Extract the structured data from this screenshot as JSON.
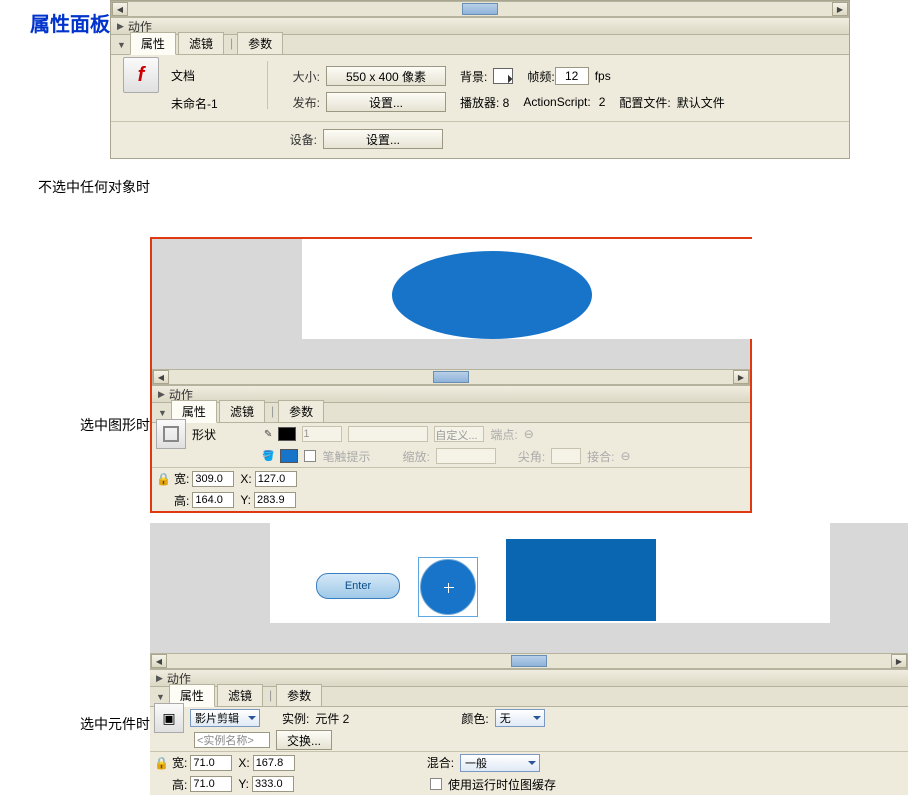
{
  "title": "属性面板",
  "labels": {
    "no_selection": "不选中任何对象时",
    "shape_selected": "选中图形时",
    "symbol_selected": "选中元件时"
  },
  "panel_header": {
    "actions": "动作"
  },
  "tabs": {
    "properties": "属性",
    "filters": "滤镜",
    "params": "参数"
  },
  "p1": {
    "doc_type": "文档",
    "doc_name": "未命名-1",
    "size_k": "大小:",
    "size_btn": "550 x 400 像素",
    "bg_k": "背景:",
    "fps_k": "帧频:",
    "fps_v": "12",
    "fps_unit": "fps",
    "publish_k": "发布:",
    "settings_btn": "设置...",
    "player_k": "播放器: 8",
    "as_k": "ActionScript:",
    "as_v": "2",
    "profile_k": "配置文件:",
    "profile_v": "默认文件",
    "device_k": "设备:"
  },
  "p2": {
    "shape_label": "形状",
    "stroke_hint": "1",
    "brush_hint": "笔触提示",
    "scale_k": "缩放:",
    "custom": "自定义...",
    "cap_k": "端点:",
    "miter_k": "尖角:",
    "join_k": "接合:",
    "w_k": "宽:",
    "w_v": "309.0",
    "h_k": "高:",
    "h_v": "164.0",
    "x_k": "X:",
    "x_v": "127.0",
    "y_k": "Y:",
    "y_v": "283.9"
  },
  "p3": {
    "enter_text": "Enter",
    "type_dd": "影片剪辑",
    "instance_k": "实例:",
    "instance_v": "元件 2",
    "color_k": "颜色:",
    "color_v": "无",
    "instance_name_ph": "<实例名称>",
    "swap_btn": "交换...",
    "blend_k": "混合:",
    "blend_v": "一般",
    "cache_k": "使用运行时位图缓存",
    "w_k": "宽:",
    "w_v": "71.0",
    "h_k": "高:",
    "h_v": "71.0",
    "x_k": "X:",
    "x_v": "167.8",
    "y_k": "Y:",
    "y_v": "333.0"
  }
}
